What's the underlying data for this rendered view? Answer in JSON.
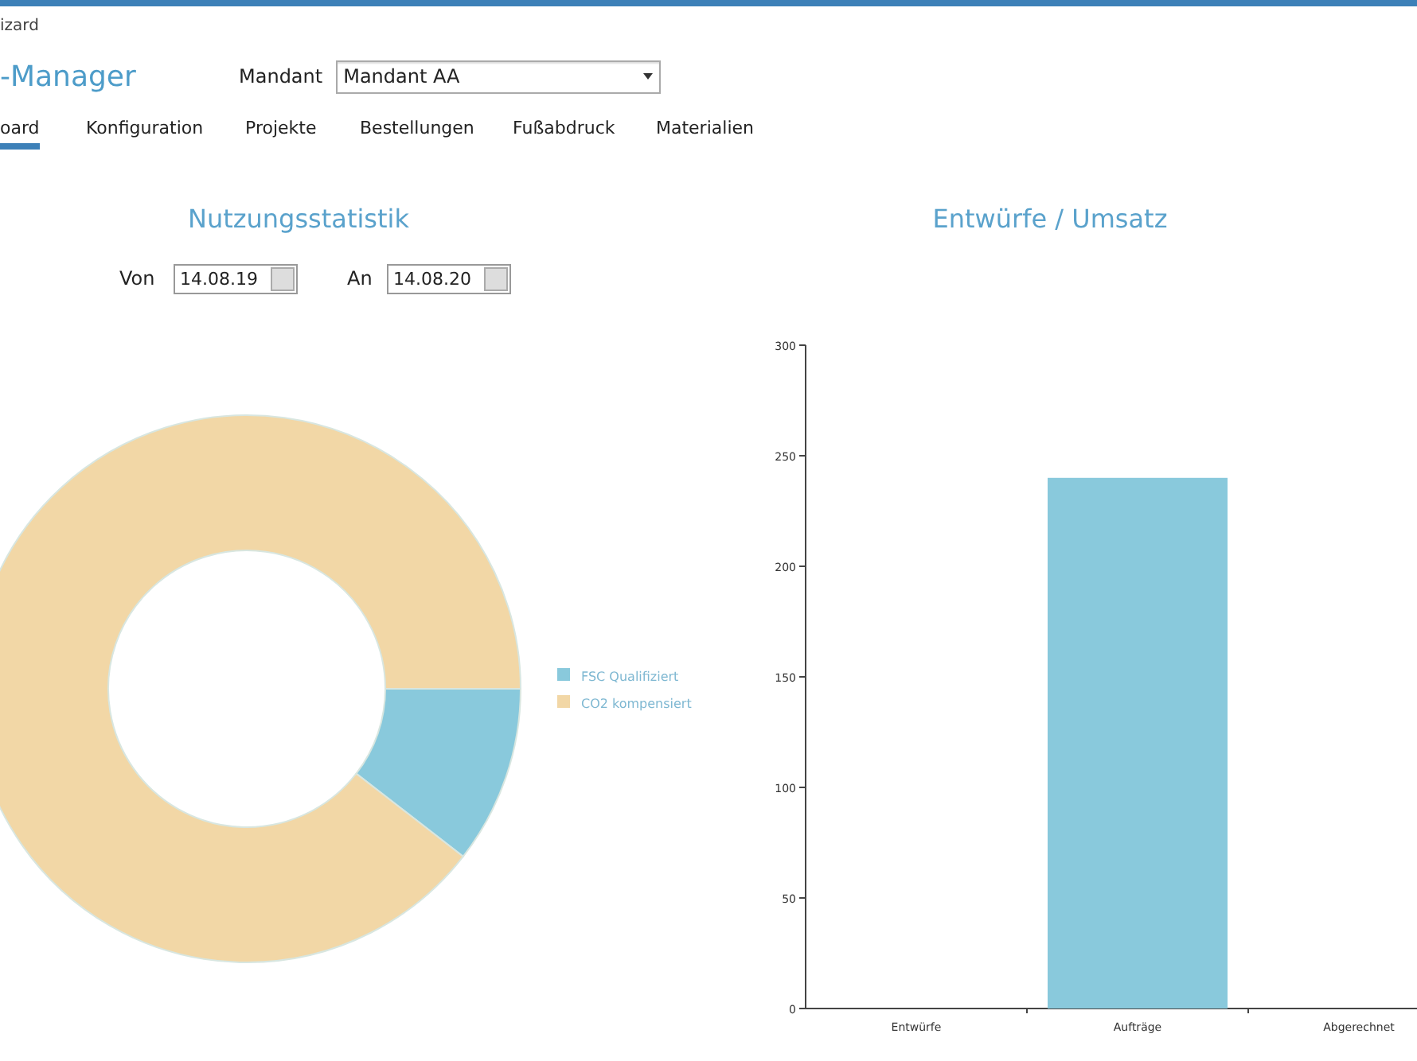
{
  "window": {
    "title": "izard"
  },
  "app_title": "-Manager",
  "mandant": {
    "label": "Mandant",
    "value": "Mandant AA"
  },
  "tabs": [
    {
      "label": "oard",
      "selected": true
    },
    {
      "label": "Konfiguration",
      "selected": false
    },
    {
      "label": "Projekte",
      "selected": false
    },
    {
      "label": "Bestellungen",
      "selected": false
    },
    {
      "label": "Fußabdruck",
      "selected": false
    },
    {
      "label": "Materialien",
      "selected": false
    }
  ],
  "usage": {
    "title": "Nutzungsstatistik",
    "from": {
      "label": "Von",
      "value": "14.08.19"
    },
    "to": {
      "label": "An",
      "value": "14.08.20"
    },
    "legend": [
      {
        "label": "FSC Qualifiziert",
        "color": "#89c9dc"
      },
      {
        "label": "CO2 kompensiert",
        "color": "#f2d7a6"
      }
    ]
  },
  "sales": {
    "title": "Entwürfe / Umsatz",
    "chart_data": {
      "type": "bar",
      "categories": [
        "Entwürfe",
        "Aufträge",
        "Abgerechnet"
      ],
      "values": [
        0,
        240,
        0
      ],
      "ylim": [
        0,
        300
      ],
      "yticks": [
        0,
        50,
        100,
        150,
        200,
        250,
        300
      ],
      "color": "#89c9dc"
    }
  }
}
